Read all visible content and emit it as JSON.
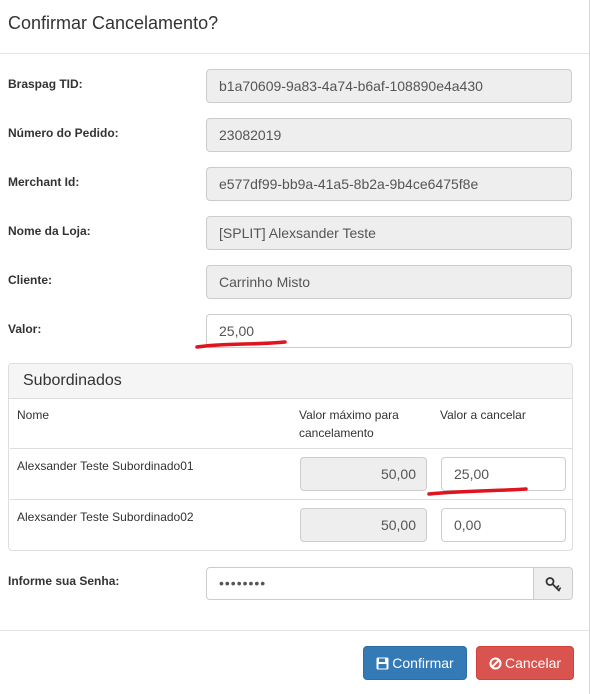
{
  "modal": {
    "title": "Confirmar Cancelamento?"
  },
  "form": {
    "braspag_tid": {
      "label": "Braspag TID:",
      "value": "b1a70609-9a83-4a74-b6af-108890e4a430"
    },
    "numero_pedido": {
      "label": "Número do Pedido:",
      "value": "23082019"
    },
    "merchant_id": {
      "label": "Merchant Id:",
      "value": "e577df99-bb9a-41a5-8b2a-9b4ce6475f8e"
    },
    "nome_loja": {
      "label": "Nome da Loja:",
      "value": "[SPLIT] Alexsander Teste"
    },
    "cliente": {
      "label": "Cliente:",
      "value": "Carrinho Misto"
    },
    "valor": {
      "label": "Valor:",
      "value": "25,00"
    },
    "senha": {
      "label": "Informe sua Senha:",
      "value": "••••••••"
    }
  },
  "subordinados": {
    "title": "Subordinados",
    "columns": [
      "Nome",
      "Valor máximo para cancelamento",
      "Valor a cancelar"
    ],
    "rows": [
      {
        "nome": "Alexsander Teste Subordinado01",
        "valor_maximo": "50,00",
        "valor_cancelar": "25,00"
      },
      {
        "nome": "Alexsander Teste Subordinado02",
        "valor_maximo": "50,00",
        "valor_cancelar": "0,00"
      }
    ]
  },
  "buttons": {
    "confirmar": "Confirmar",
    "cancelar": "Cancelar"
  },
  "icons": {
    "save": "floppy-disk-icon",
    "cancel": "ban-icon",
    "key": "key-icon"
  },
  "colors": {
    "primary": "#337ab7",
    "danger": "#d9534f",
    "annotation": "#e0141e"
  }
}
